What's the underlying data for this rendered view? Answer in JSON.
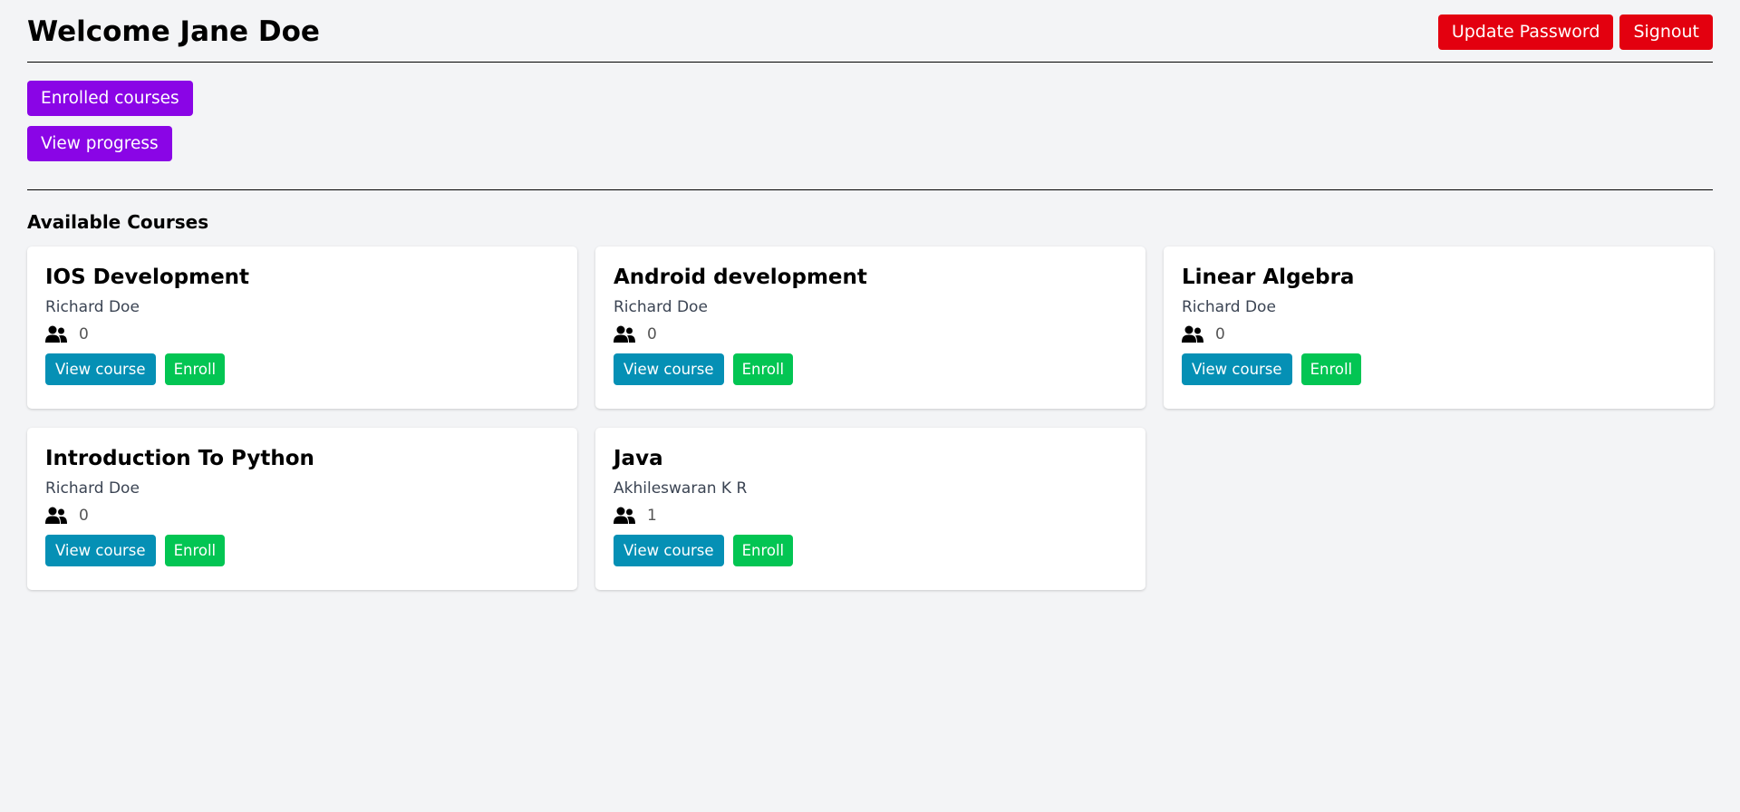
{
  "header": {
    "welcome": "Welcome Jane Doe",
    "update_password_label": "Update Password",
    "signout_label": "Signout"
  },
  "nav": {
    "enrolled_courses_label": "Enrolled courses",
    "view_progress_label": "View progress"
  },
  "section_title": "Available Courses",
  "courses": [
    {
      "title": "IOS Development",
      "author": "Richard Doe",
      "enrolled_count": "0",
      "view_label": "View course",
      "enroll_label": "Enroll"
    },
    {
      "title": "Android development",
      "author": "Richard Doe",
      "enrolled_count": "0",
      "view_label": "View course",
      "enroll_label": "Enroll"
    },
    {
      "title": "Linear Algebra",
      "author": "Richard Doe",
      "enrolled_count": "0",
      "view_label": "View course",
      "enroll_label": "Enroll"
    },
    {
      "title": "Introduction To Python",
      "author": "Richard Doe",
      "enrolled_count": "0",
      "view_label": "View course",
      "enroll_label": "Enroll"
    },
    {
      "title": "Java",
      "author": "Akhileswaran K R",
      "enrolled_count": "1",
      "view_label": "View course",
      "enroll_label": "Enroll"
    }
  ],
  "icons": {
    "enrolled_count_icon": "users-icon"
  },
  "colors": {
    "danger": "#e3000f",
    "primary": "#8a05e6",
    "view_button": "#0590b5",
    "enroll_button": "#03c553",
    "background": "#f3f4f6"
  }
}
